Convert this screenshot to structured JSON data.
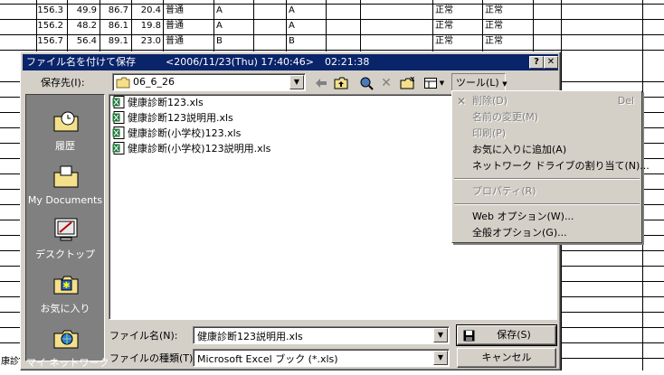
{
  "sheet": {
    "rows": [
      [
        "156.3",
        "49.9",
        "86.7",
        "20.4",
        "普通",
        "A",
        "A",
        "正常",
        "正常"
      ],
      [
        "156.2",
        "48.2",
        "86.1",
        "19.8",
        "普通",
        "A",
        "A",
        "正常",
        "正常"
      ],
      [
        "156.7",
        "56.4",
        "89.1",
        "23.0",
        "普通",
        "B",
        "B",
        "正常",
        "正常"
      ]
    ],
    "bottom_left_text": "康診"
  },
  "dialog": {
    "title": "ファイル名を付けて保存",
    "title_timestamp": "<2006/11/23(Thu) 17:40:46>",
    "title_elapsed": "02:21:38",
    "help_button": "?",
    "close_button": "✕",
    "save_in_label": "保存先(I):",
    "save_in_value": "06_6_26",
    "tools_button": "ツール(L)",
    "places": [
      {
        "label": "履歴"
      },
      {
        "label": "My Documents"
      },
      {
        "label": "デスクトップ"
      },
      {
        "label": "お気に入り"
      },
      {
        "label": "マイ ネットワーク"
      }
    ],
    "files": [
      "健康診断123.xls",
      "健康診断123説明用.xls",
      "健康診断(小学校)123.xls",
      "健康診断(小学校)123説明用.xls"
    ],
    "filename_label": "ファイル名(N):",
    "filename_value": "健康診断123説明用.xls",
    "filetype_label": "ファイルの種類(T):",
    "filetype_value": "Microsoft Excel ブック (*.xls)",
    "save_button": "保存(S)",
    "cancel_button": "キャンセル"
  },
  "tools_menu": {
    "items": [
      {
        "label": "削除(D)",
        "shortcut": "Del",
        "disabled": true
      },
      {
        "label": "名前の変更(M)",
        "disabled": true
      },
      {
        "label": "印刷(P)",
        "disabled": true
      },
      {
        "label": "お気に入りに追加(A)",
        "disabled": false
      },
      {
        "label": "ネットワーク ドライブの割り当て(N)...",
        "disabled": false
      },
      {
        "label": "プロパティ(R)",
        "disabled": true
      },
      {
        "label": "Web オプション(W)...",
        "disabled": false
      },
      {
        "label": "全般オプション(G)...",
        "disabled": false
      }
    ]
  },
  "colors": {
    "titlebar": "#0a246a",
    "dialog_face": "#d4d0c8",
    "places_bar": "#808080"
  }
}
